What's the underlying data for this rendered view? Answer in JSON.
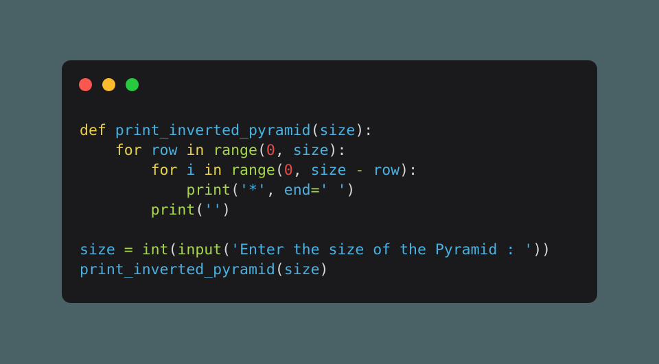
{
  "window": {
    "background_color": "#4a6166",
    "card_background": "#1a1a1c",
    "traffic_lights": [
      {
        "name": "close",
        "color": "#fa5750"
      },
      {
        "name": "minimize",
        "color": "#fcbb2c"
      },
      {
        "name": "maximize",
        "color": "#27c93f"
      }
    ]
  },
  "theme": {
    "keyword_color": "#e7d04b",
    "function_color": "#49b0e0",
    "identifier_color": "#49b0e0",
    "builtin_color": "#a5d64c",
    "operator_color": "#a5d64c",
    "number_color": "#e54b4b",
    "string_color": "#49b0e0",
    "punctuation_color": "#d6d6d6"
  },
  "code": {
    "language": "python",
    "lines": [
      "def print_inverted_pyramid(size):",
      "    for row in range(0, size):",
      "        for i in range(0, size - row):",
      "            print('*', end=' ')",
      "        print('')",
      "",
      "size = int(input('Enter the size of the Pyramid : '))",
      "print_inverted_pyramid(size)"
    ],
    "tokens": {
      "line1": {
        "kw": "def",
        "fn": "print_inverted_pyramid",
        "open": "(",
        "param": "size",
        "close": ")",
        "colon": ":"
      },
      "line2": {
        "kw_for": "for",
        "var": "row",
        "kw_in": "in",
        "builtin": "range",
        "open": "(",
        "num": "0",
        "comma": ", ",
        "arg": "size",
        "close": ")",
        "colon": ":"
      },
      "line3": {
        "kw_for": "for",
        "var": "i",
        "kw_in": "in",
        "builtin": "range",
        "open": "(",
        "num": "0",
        "comma": ", ",
        "arg1": "size",
        "op": "-",
        "arg2": "row",
        "close": ")",
        "colon": ":"
      },
      "line4": {
        "builtin": "print",
        "open": "(",
        "str1": "'*'",
        "comma": ", ",
        "kwarg": "end",
        "eq": "=",
        "str2": "' '",
        "close": ")"
      },
      "line5": {
        "builtin": "print",
        "open": "(",
        "str": "''",
        "close": ")"
      },
      "line7": {
        "var": "size",
        "eq": "=",
        "builtin1": "int",
        "open1": "(",
        "builtin2": "input",
        "open2": "(",
        "str": "'Enter the size of the Pyramid : '",
        "close": "))"
      },
      "line8": {
        "fn": "print_inverted_pyramid",
        "open": "(",
        "arg": "size",
        "close": ")"
      }
    }
  }
}
